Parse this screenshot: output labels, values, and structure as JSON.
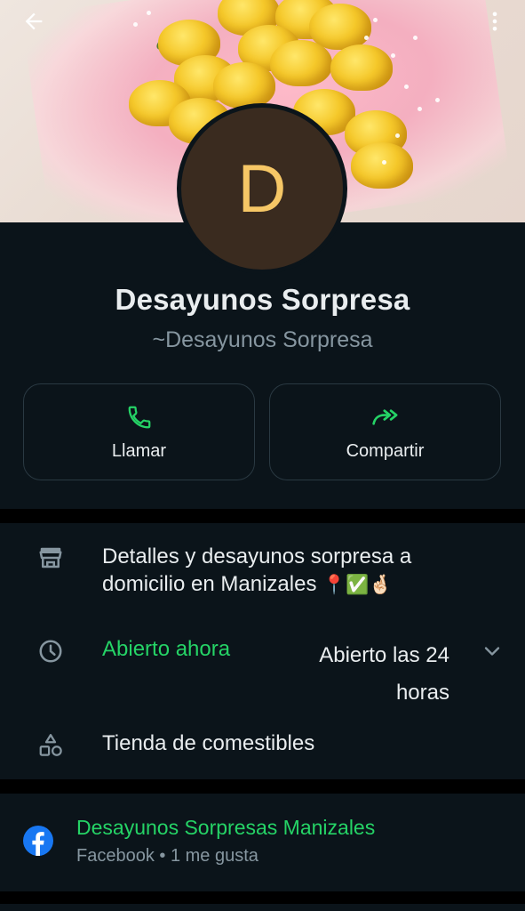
{
  "header": {
    "back_icon": "arrow-left-icon",
    "menu_icon": "more-vertical-icon"
  },
  "profile": {
    "avatar_letter": "D",
    "name": "Desayunos Sorpresa",
    "push_name": "~Desayunos Sorpresa"
  },
  "actions": {
    "call_label": "Llamar",
    "share_label": "Compartir"
  },
  "business": {
    "description": "Detalles y desayunos sorpresa a domicilio en Manizales",
    "description_emojis": "📍✅🤞🏻",
    "open_status": "Abierto ahora",
    "hours_line1": "Abierto las 24",
    "hours_line2": "horas",
    "category": "Tienda de comestibles"
  },
  "facebook": {
    "page_name": "Desayunos Sorpresas Manizales",
    "subtitle": "Facebook • 1 me gusta"
  },
  "colors": {
    "background": "#0b141a",
    "accent_green": "#25d366",
    "avatar_bg": "#3a2b1f",
    "avatar_letter": "#f6c766",
    "facebook_blue": "#1877f2",
    "secondary_text": "#8696a0"
  }
}
